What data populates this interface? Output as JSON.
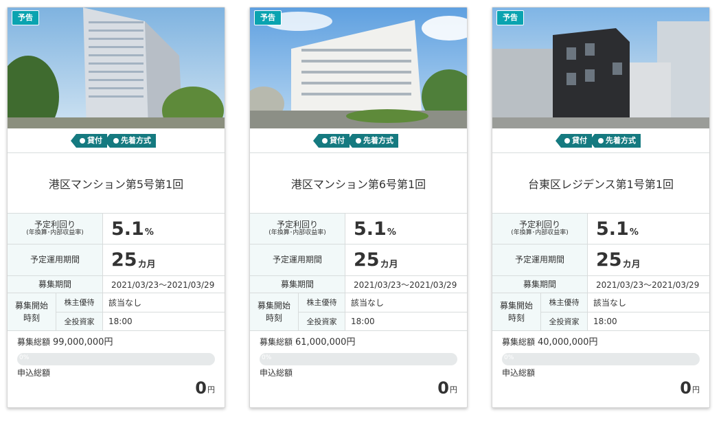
{
  "cards": [
    {
      "badge": "予告",
      "tags": [
        "貸付",
        "先着方式"
      ],
      "title": "港区マンション第5号第1回",
      "yield_label": "予定利回り",
      "yield_sub": "(年換算･内部収益率)",
      "yield_value": "5.1",
      "yield_unit": "%",
      "period_label": "予定運用期間",
      "period_value": "25",
      "period_unit": "カ月",
      "recruit_label": "募集期間",
      "recruit_value": "2021/03/23～2021/03/29",
      "start_label_1": "募集開始",
      "start_label_2": "時刻",
      "shareholder_label": "株主優待",
      "shareholder_value": "該当なし",
      "all_label": "全投資家",
      "all_value": "18:00",
      "total_label": "募集総額",
      "total_value": "99,000,000円",
      "progress_pct": "0%",
      "progress": 0,
      "apply_label": "申込総額",
      "apply_value": "0",
      "apply_unit": "円"
    },
    {
      "badge": "予告",
      "tags": [
        "貸付",
        "先着方式"
      ],
      "title": "港区マンション第6号第1回",
      "yield_label": "予定利回り",
      "yield_sub": "(年換算･内部収益率)",
      "yield_value": "5.1",
      "yield_unit": "%",
      "period_label": "予定運用期間",
      "period_value": "25",
      "period_unit": "カ月",
      "recruit_label": "募集期間",
      "recruit_value": "2021/03/23～2021/03/29",
      "start_label_1": "募集開始",
      "start_label_2": "時刻",
      "shareholder_label": "株主優待",
      "shareholder_value": "該当なし",
      "all_label": "全投資家",
      "all_value": "18:00",
      "total_label": "募集総額",
      "total_value": "61,000,000円",
      "progress_pct": "0%",
      "progress": 0,
      "apply_label": "申込総額",
      "apply_value": "0",
      "apply_unit": "円"
    },
    {
      "badge": "予告",
      "tags": [
        "貸付",
        "先着方式"
      ],
      "title": "台東区レジデンス第1号第1回",
      "yield_label": "予定利回り",
      "yield_sub": "(年換算･内部収益率)",
      "yield_value": "5.1",
      "yield_unit": "%",
      "period_label": "予定運用期間",
      "period_value": "25",
      "period_unit": "カ月",
      "recruit_label": "募集期間",
      "recruit_value": "2021/03/23～2021/03/29",
      "start_label_1": "募集開始",
      "start_label_2": "時刻",
      "shareholder_label": "株主優待",
      "shareholder_value": "該当なし",
      "all_label": "全投資家",
      "all_value": "18:00",
      "total_label": "募集総額",
      "total_value": "40,000,000円",
      "progress_pct": "0%",
      "progress": 0,
      "apply_label": "申込総額",
      "apply_value": "0",
      "apply_unit": "円"
    }
  ],
  "colors": {
    "badge": "#0aa3b0",
    "tag": "#157a80",
    "label_bg": "#f2f9f9"
  }
}
